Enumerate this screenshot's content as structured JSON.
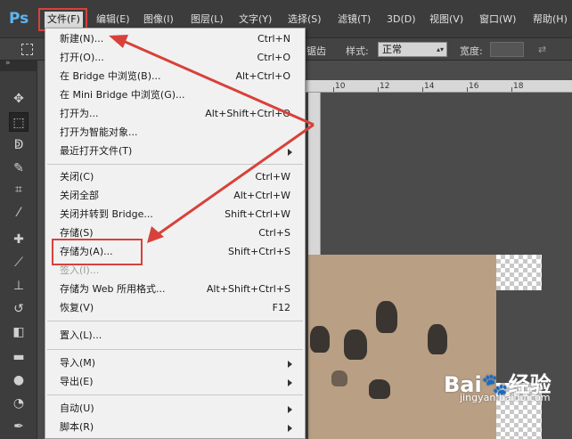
{
  "app": {
    "logo": "Ps"
  },
  "menubar": {
    "items": [
      "文件(F)",
      "编辑(E)",
      "图像(I)",
      "图层(L)",
      "文字(Y)",
      "选择(S)",
      "滤镜(T)",
      "3D(D)",
      "视图(V)",
      "窗口(W)",
      "帮助(H)"
    ]
  },
  "options": {
    "style_label": "样式:",
    "style_value": "正常",
    "width_label": "宽度:",
    "partial_text": "锯齿"
  },
  "ruler": {
    "ticks": [
      "10",
      "12",
      "14",
      "16",
      "18"
    ]
  },
  "file_menu": {
    "items": [
      {
        "label": "新建(N)...",
        "shortcut": "Ctrl+N"
      },
      {
        "label": "打开(O)...",
        "shortcut": "Ctrl+O"
      },
      {
        "label": "在 Bridge 中浏览(B)...",
        "shortcut": "Alt+Ctrl+O"
      },
      {
        "label": "在 Mini Bridge 中浏览(G)...",
        "shortcut": ""
      },
      {
        "label": "打开为...",
        "shortcut": "Alt+Shift+Ctrl+O"
      },
      {
        "label": "打开为智能对象...",
        "shortcut": ""
      },
      {
        "label": "最近打开文件(T)",
        "shortcut": ""
      },
      {
        "label": "关闭(C)",
        "shortcut": "Ctrl+W"
      },
      {
        "label": "关闭全部",
        "shortcut": "Alt+Ctrl+W"
      },
      {
        "label": "关闭并转到 Bridge...",
        "shortcut": "Shift+Ctrl+W"
      },
      {
        "label": "存储(S)",
        "shortcut": "Ctrl+S"
      },
      {
        "label": "存储为(A)...",
        "shortcut": "Shift+Ctrl+S"
      },
      {
        "label": "签入(I)...",
        "shortcut": ""
      },
      {
        "label": "存储为 Web 所用格式...",
        "shortcut": "Alt+Shift+Ctrl+S"
      },
      {
        "label": "恢复(V)",
        "shortcut": "F12"
      },
      {
        "label": "置入(L)...",
        "shortcut": ""
      },
      {
        "label": "导入(M)",
        "shortcut": ""
      },
      {
        "label": "导出(E)",
        "shortcut": ""
      },
      {
        "label": "自动(U)",
        "shortcut": ""
      },
      {
        "label": "脚本(R)",
        "shortcut": ""
      }
    ]
  },
  "watermark": {
    "logo": "Bai🐾经验",
    "url": "jingyan.baidu.com"
  },
  "colors": {
    "highlight": "#d8413a",
    "menubar": "#3c3c3c",
    "menu_bg": "#f1f1f1",
    "ps_blue": "#5fb4f0"
  },
  "tools": [
    "move-icon",
    "marquee-icon",
    "lasso-icon",
    "quick-select-icon",
    "crop-icon",
    "eyedropper-icon",
    "healing-icon",
    "brush-icon",
    "stamp-icon",
    "history-brush-icon",
    "eraser-icon",
    "gradient-icon",
    "blur-icon",
    "dodge-icon",
    "pen-icon"
  ]
}
